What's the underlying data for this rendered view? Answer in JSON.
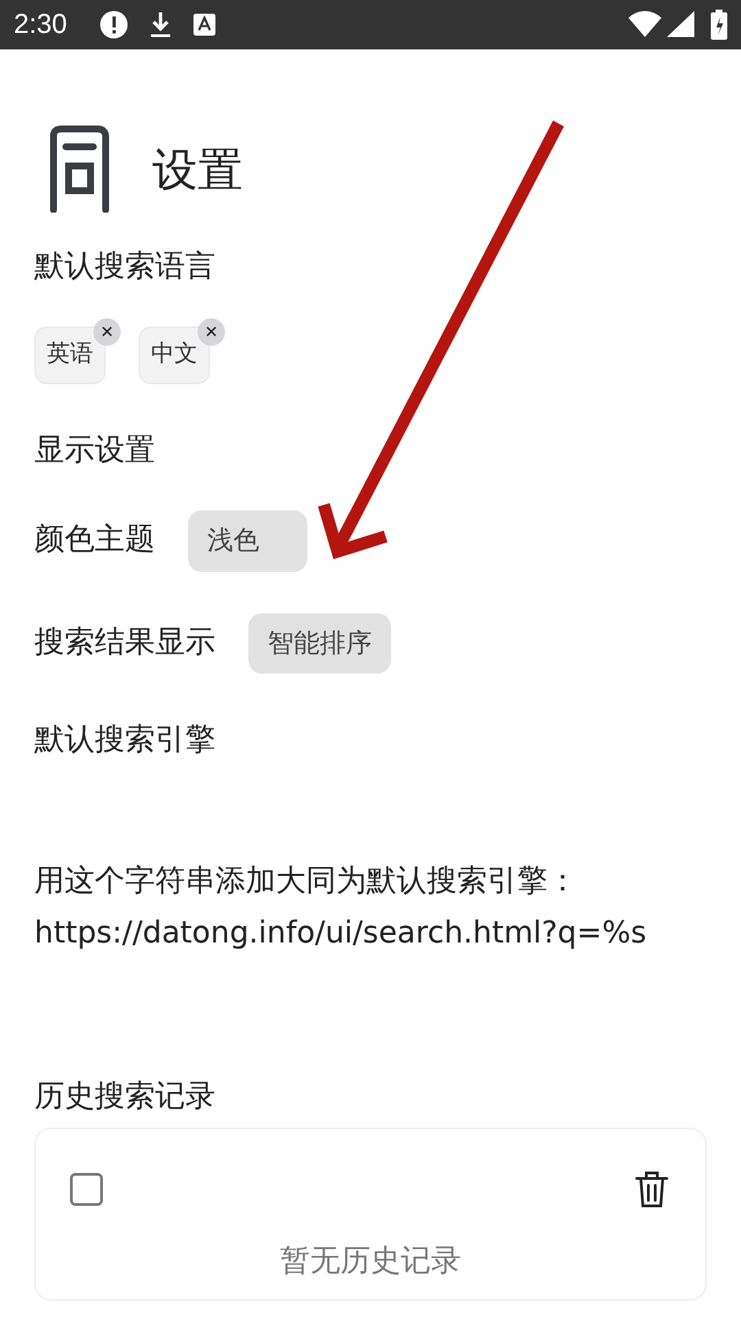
{
  "status_bar": {
    "time": "2:30"
  },
  "header": {
    "title": "设置"
  },
  "sections": [
    {
      "kind": "chips",
      "title": "默认搜索语言",
      "chips": [
        {
          "label": "英语",
          "remove": "✕"
        },
        {
          "label": "中文",
          "remove": "✕"
        }
      ]
    },
    {
      "kind": "heading",
      "title": "显示设置"
    },
    {
      "kind": "select",
      "title": "颜色主题",
      "value": "浅色"
    },
    {
      "kind": "select",
      "title": "搜索结果显示",
      "value": "智能排序"
    },
    {
      "kind": "heading",
      "title": "默认搜索引擎"
    },
    {
      "kind": "text",
      "lines": [
        "用这个字符串添加大同为默认搜索引擎：",
        "https://datong.info/ui/search.html?q=%s"
      ]
    },
    {
      "kind": "history",
      "title": "历史搜索记录",
      "select_all": {
        "checked": false
      },
      "empty_text": "暂无历史记录"
    }
  ]
}
